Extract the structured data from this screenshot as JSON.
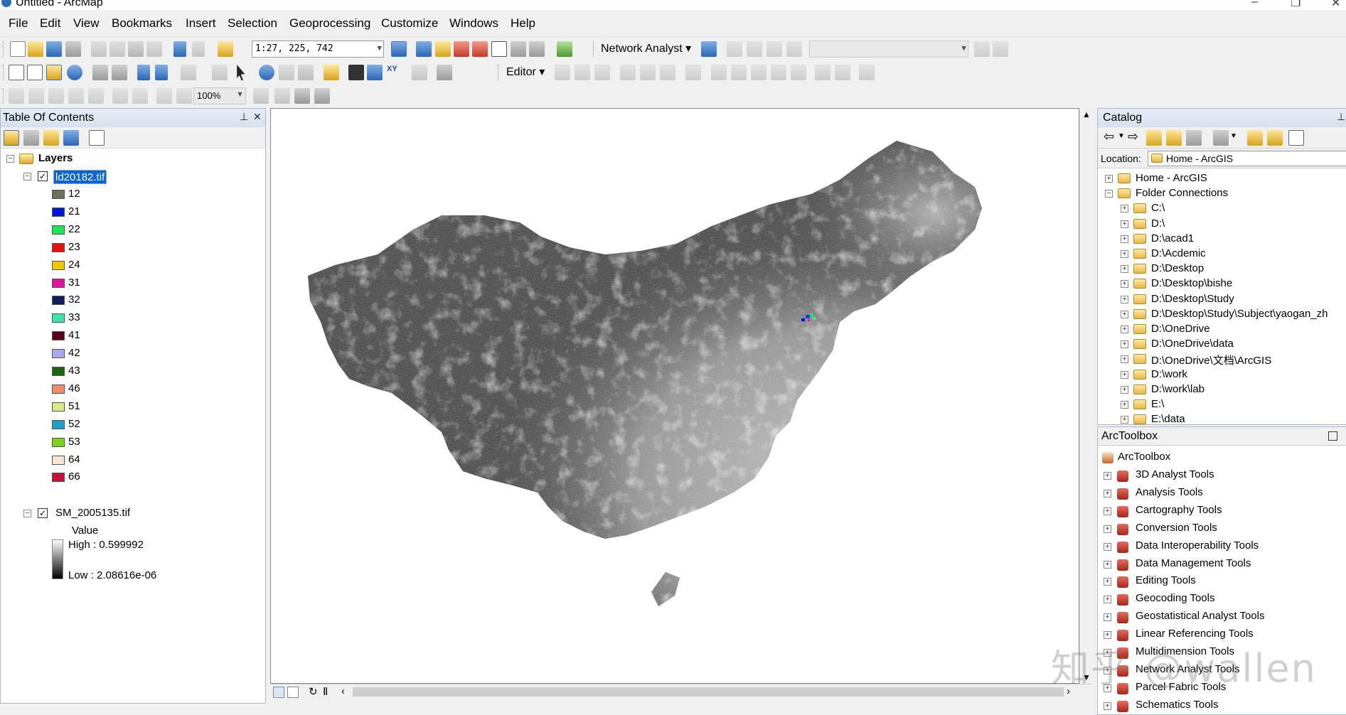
{
  "window": {
    "title": "Untitled - ArcMap",
    "min": "–",
    "max": "❐",
    "close": "✕"
  },
  "menu": [
    "File",
    "Edit",
    "View",
    "Bookmarks",
    "Insert",
    "Selection",
    "Geoprocessing",
    "Customize",
    "Windows",
    "Help"
  ],
  "toolbar": {
    "scale": "1:27, 225, 742",
    "network_analyst": "Network Analyst ▾",
    "editor": "Editor ▾",
    "zoom": "100%"
  },
  "toc": {
    "title": "Table Of Contents",
    "pin": "ᵩ",
    "close": "✕",
    "layers_label": "Layers",
    "layer1": {
      "name": "ld20182.tif",
      "classes": [
        {
          "label": "12",
          "color": "#6f6f59"
        },
        {
          "label": "21",
          "color": "#0016d4"
        },
        {
          "label": "22",
          "color": "#1ee650"
        },
        {
          "label": "23",
          "color": "#e61010"
        },
        {
          "label": "24",
          "color": "#f0c800"
        },
        {
          "label": "31",
          "color": "#e0139b"
        },
        {
          "label": "32",
          "color": "#0c1f5c"
        },
        {
          "label": "33",
          "color": "#3ce6a6"
        },
        {
          "label": "41",
          "color": "#5a0018"
        },
        {
          "label": "42",
          "color": "#a8a8f0"
        },
        {
          "label": "43",
          "color": "#1c6414"
        },
        {
          "label": "46",
          "color": "#f08a6a"
        },
        {
          "label": "51",
          "color": "#d4ec8a"
        },
        {
          "label": "52",
          "color": "#1ea0c8"
        },
        {
          "label": "53",
          "color": "#7ad21e"
        },
        {
          "label": "64",
          "color": "#f6e6d4"
        },
        {
          "label": "66",
          "color": "#c8103c"
        }
      ]
    },
    "layer2": {
      "name": "SM_2005135.tif",
      "value_label": "Value",
      "high": "High : 0.599992",
      "low": "Low : 2.08616e-06"
    }
  },
  "catalog": {
    "title": "Catalog",
    "location_label": "Location:",
    "location_value": "Home - ArcGIS",
    "items": [
      {
        "label": "Home - ArcGIS",
        "level": 0,
        "exp": "+"
      },
      {
        "label": "Folder Connections",
        "level": 0,
        "exp": "−"
      },
      {
        "label": "C:\\",
        "level": 1,
        "exp": "+"
      },
      {
        "label": "D:\\",
        "level": 1,
        "exp": "+"
      },
      {
        "label": "D:\\acad1",
        "level": 1,
        "exp": "+"
      },
      {
        "label": "D:\\Acdemic",
        "level": 1,
        "exp": "+"
      },
      {
        "label": "D:\\Desktop",
        "level": 1,
        "exp": "+"
      },
      {
        "label": "D:\\Desktop\\bishe",
        "level": 1,
        "exp": "+"
      },
      {
        "label": "D:\\Desktop\\Study",
        "level": 1,
        "exp": "+"
      },
      {
        "label": "D:\\Desktop\\Study\\Subject\\yaogan_zh",
        "level": 1,
        "exp": "+"
      },
      {
        "label": "D:\\OneDrive",
        "level": 1,
        "exp": "+"
      },
      {
        "label": "D:\\OneDrive\\data",
        "level": 1,
        "exp": "+"
      },
      {
        "label": "D:\\OneDrive\\文档\\ArcGIS",
        "level": 1,
        "exp": "+"
      },
      {
        "label": "D:\\work",
        "level": 1,
        "exp": "+"
      },
      {
        "label": "D:\\work\\lab",
        "level": 1,
        "exp": "+"
      },
      {
        "label": "E:\\",
        "level": 1,
        "exp": "+"
      },
      {
        "label": "E:\\data",
        "level": 1,
        "exp": "+"
      }
    ]
  },
  "toolbox": {
    "title": "ArcToolbox",
    "root": "ArcToolbox",
    "items": [
      "3D Analyst Tools",
      "Analysis Tools",
      "Cartography Tools",
      "Conversion Tools",
      "Data Interoperability Tools",
      "Data Management Tools",
      "Editing Tools",
      "Geocoding Tools",
      "Geostatistical Analyst Tools",
      "Linear Referencing Tools",
      "Multidimension Tools",
      "Network Analyst Tools",
      "Parcel Fabric Tools",
      "Schematics Tools"
    ]
  },
  "watermark": "知乎 @wallen"
}
